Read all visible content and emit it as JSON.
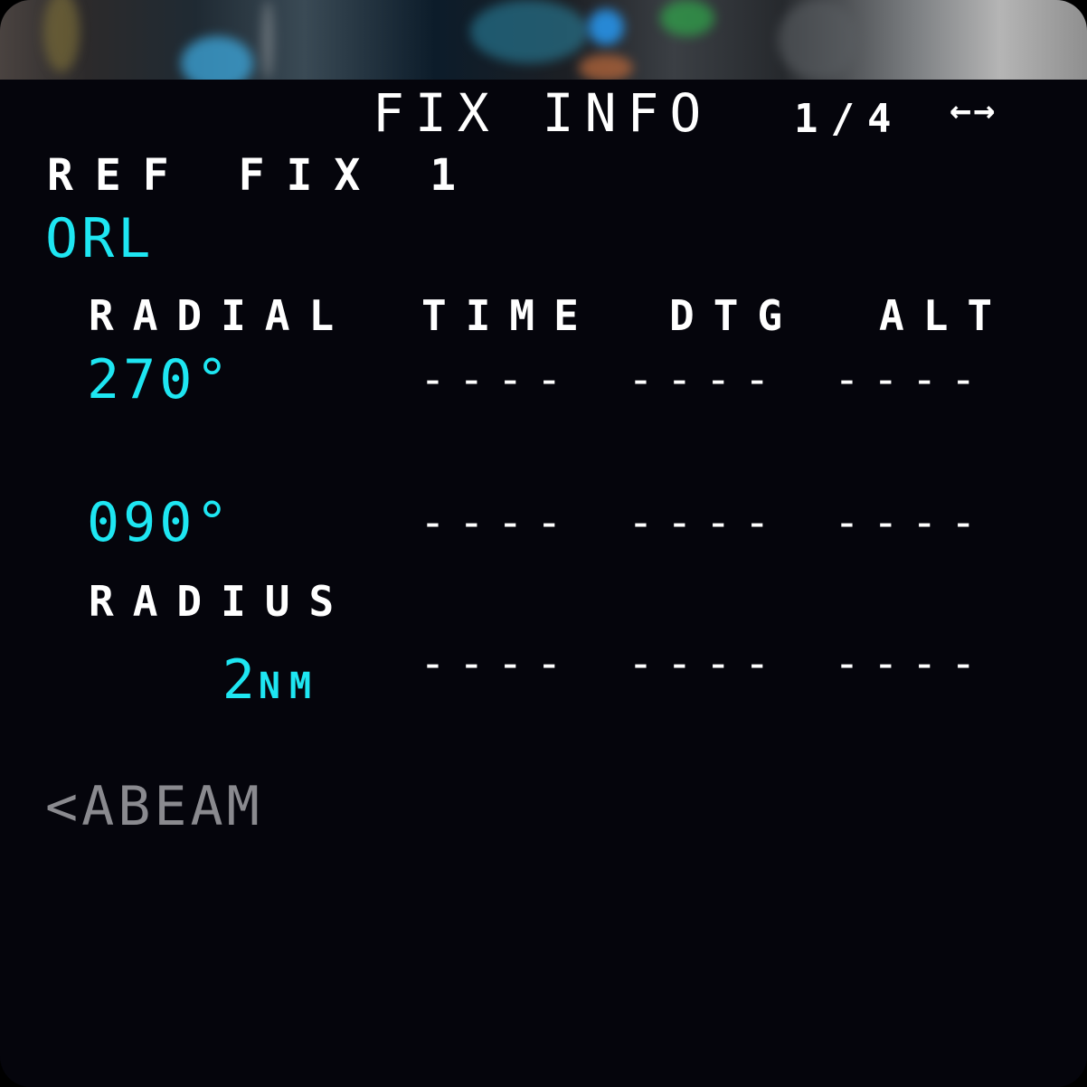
{
  "page": {
    "title": "FIX INFO",
    "page_number": "1/4",
    "nav_arrows": "←→"
  },
  "ref_fix": {
    "label": "REF FIX 1",
    "value": "ORL"
  },
  "columns": {
    "radial": "RADIAL",
    "time": "TIME",
    "dtg": "DTG",
    "alt": "ALT"
  },
  "rows": [
    {
      "radial": "270°",
      "time": "----",
      "dtg": "----",
      "alt": "----"
    },
    {
      "radial": "090°",
      "time": "----",
      "dtg": "----",
      "alt": "----"
    }
  ],
  "radius": {
    "label": "RADIUS",
    "value": "2",
    "unit": "NM",
    "time": "----",
    "dtg": "----",
    "alt": "----"
  },
  "abeam": {
    "label": "<ABEAM"
  },
  "colors": {
    "background": "#05050c",
    "label": "#ffffff",
    "data": "#1ee6f2",
    "inactive": "#8a8a8f"
  }
}
